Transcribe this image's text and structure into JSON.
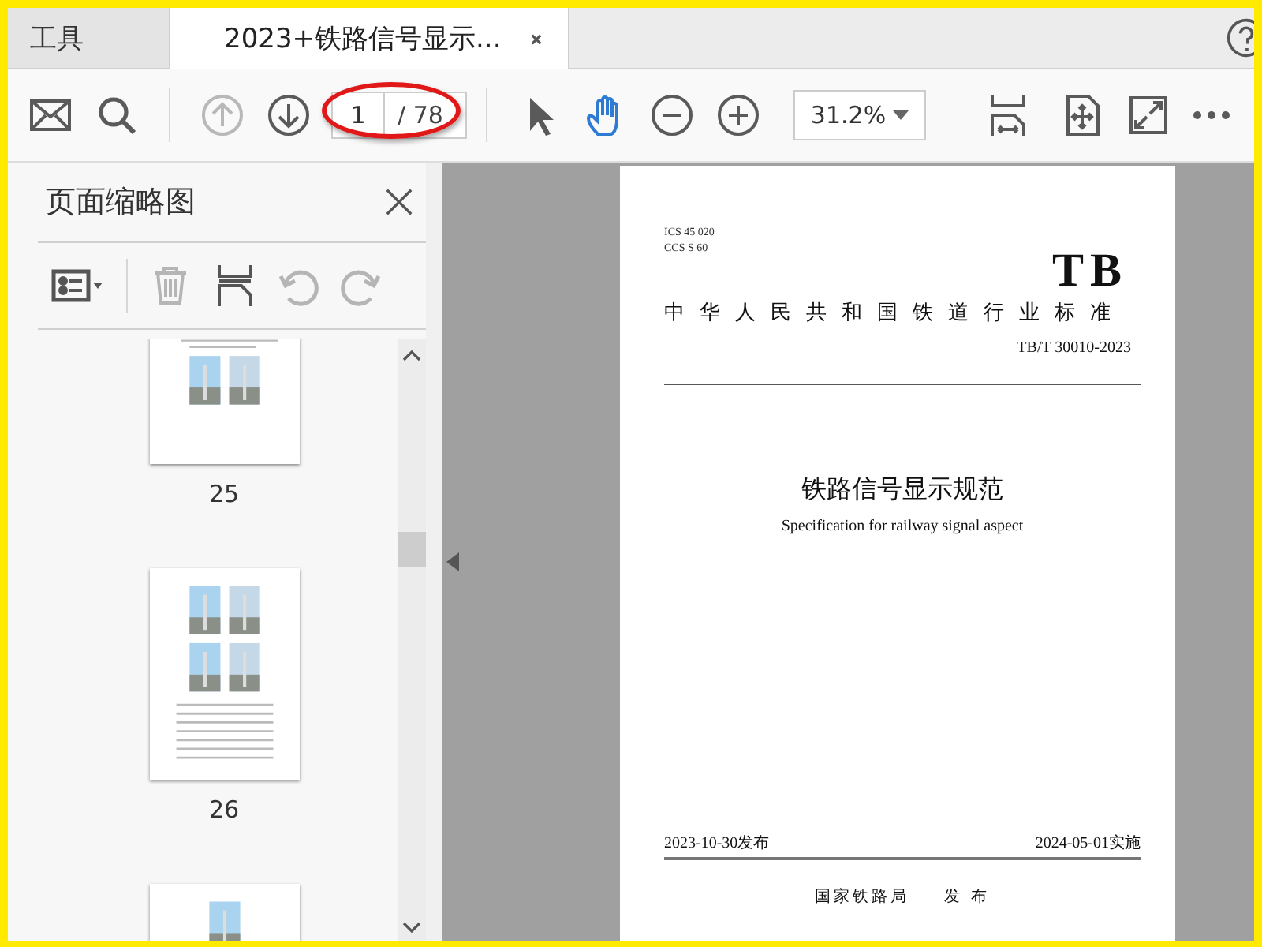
{
  "tabs": [
    {
      "label": "工具",
      "selected": false,
      "closable": false
    },
    {
      "label": "2023+铁路信号显示...",
      "selected": true,
      "closable": true
    }
  ],
  "toolbar": {
    "nav": [
      {
        "kind": "up",
        "disabled": true
      },
      {
        "kind": "down",
        "disabled": false
      }
    ],
    "page_number": "1",
    "page_total": "/ 78",
    "tools": [
      {
        "kind": "select",
        "selected": false
      },
      {
        "kind": "hand",
        "selected": true
      }
    ],
    "zoom": "31.2%"
  },
  "sidebar": {
    "title": "页面缩略图",
    "tools": [
      {
        "kind": "trash",
        "disabled": true
      },
      {
        "kind": "extract",
        "disabled": false
      },
      {
        "kind": "rotate-left",
        "disabled": true
      },
      {
        "kind": "rotate-right",
        "disabled": true
      }
    ],
    "thumbnails": [
      {
        "kind": "two-photos",
        "label": "25"
      },
      {
        "kind": "four-photos",
        "label": "26"
      },
      {
        "kind": "one-photo"
      }
    ]
  },
  "document": {
    "ics": "ICS 45 020",
    "ccs": "CCS S 60",
    "logo": "TB",
    "category": "中华人民共和国铁道行业标准",
    "code": "TB/T 30010-2023",
    "title": "铁路信号显示规范",
    "subtitle": "Specification for railway signal aspect",
    "issued": "2023-10-30发布",
    "effective": "2024-05-01实施",
    "publisher": "国家铁路局",
    "publish_word": "发 布"
  }
}
